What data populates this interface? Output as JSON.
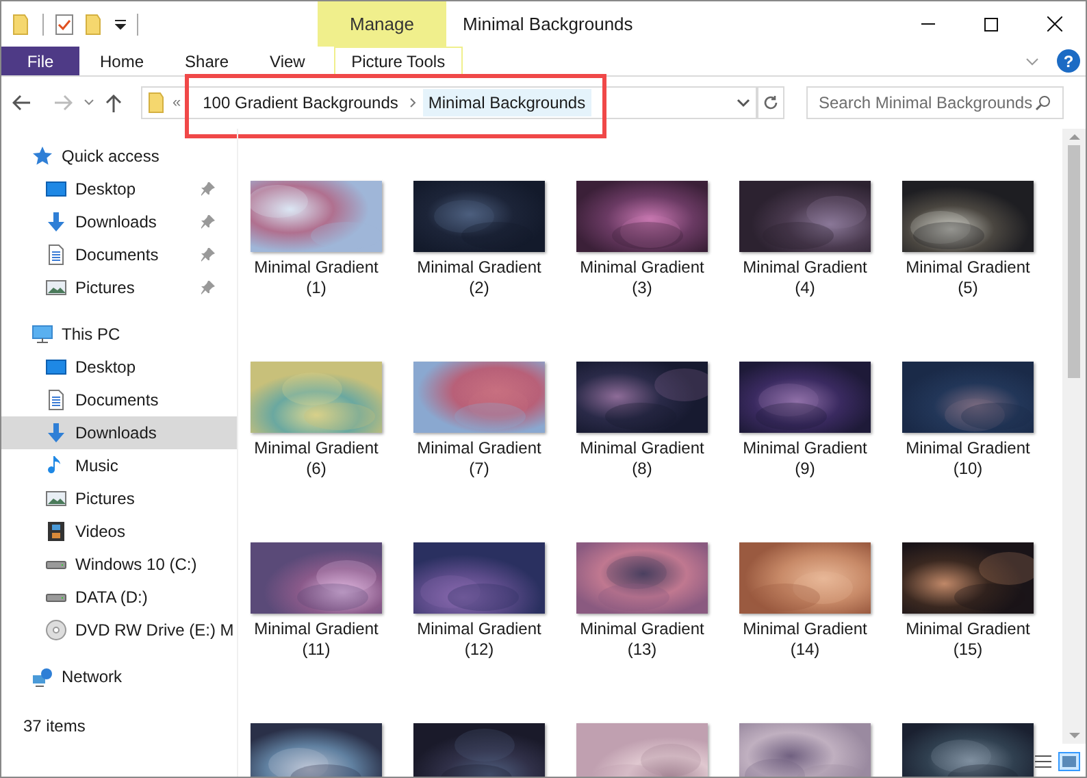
{
  "window": {
    "title": "Minimal Backgrounds"
  },
  "ribbon": {
    "context_tab": "Manage",
    "tabs": [
      {
        "label": "File",
        "kind": "file"
      },
      {
        "label": "Home",
        "kind": "tab"
      },
      {
        "label": "Share",
        "kind": "tab"
      },
      {
        "label": "View",
        "kind": "tab"
      },
      {
        "label": "Picture Tools",
        "kind": "context"
      }
    ],
    "help": "?"
  },
  "address": {
    "overflow": "«",
    "crumbs": [
      {
        "label": "100 Gradient Backgrounds",
        "selected": false
      },
      {
        "label": "Minimal Backgrounds",
        "selected": true
      }
    ]
  },
  "search": {
    "placeholder": "Search Minimal Backgrounds"
  },
  "sidebar": {
    "items": [
      {
        "label": "Quick access",
        "kind": "star",
        "selected": false,
        "children": [
          {
            "label": "Desktop",
            "kind": "desktop",
            "selected": false,
            "pinned": true
          },
          {
            "label": "Downloads",
            "kind": "download",
            "selected": false,
            "pinned": true
          },
          {
            "label": "Documents",
            "kind": "document",
            "selected": false,
            "pinned": true
          },
          {
            "label": "Pictures",
            "kind": "pictures",
            "selected": false,
            "pinned": true
          }
        ]
      },
      {
        "label": "This PC",
        "kind": "pc",
        "selected": false,
        "children": [
          {
            "label": "Desktop",
            "kind": "desktop",
            "selected": false,
            "pinned": false
          },
          {
            "label": "Documents",
            "kind": "document",
            "selected": false,
            "pinned": false
          },
          {
            "label": "Downloads",
            "kind": "download",
            "selected": true,
            "pinned": false
          },
          {
            "label": "Music",
            "kind": "music",
            "selected": false,
            "pinned": false
          },
          {
            "label": "Pictures",
            "kind": "pictures",
            "selected": false,
            "pinned": false
          },
          {
            "label": "Videos",
            "kind": "videos",
            "selected": false,
            "pinned": false
          },
          {
            "label": "Windows 10 (C:)",
            "kind": "drive",
            "selected": false,
            "pinned": false
          },
          {
            "label": "DATA (D:)",
            "kind": "drive",
            "selected": false,
            "pinned": false
          },
          {
            "label": "DVD RW Drive (E:) M",
            "kind": "dvd",
            "selected": false,
            "pinned": false
          }
        ]
      },
      {
        "label": "Network",
        "kind": "network",
        "selected": false
      }
    ]
  },
  "files": [
    {
      "kind": "file",
      "name": "Minimal Gradient",
      "number": "(1)"
    },
    {
      "kind": "file",
      "name": "Minimal Gradient",
      "number": "(2)"
    },
    {
      "kind": "file",
      "name": "Minimal Gradient",
      "number": "(3)"
    },
    {
      "kind": "file",
      "name": "Minimal Gradient",
      "number": "(4)"
    },
    {
      "kind": "file",
      "name": "Minimal Gradient",
      "number": "(5)"
    },
    {
      "kind": "file",
      "name": "Minimal Gradient",
      "number": "(6)"
    },
    {
      "kind": "file",
      "name": "Minimal Gradient",
      "number": "(7)"
    },
    {
      "kind": "file",
      "name": "Minimal Gradient",
      "number": "(8)"
    },
    {
      "kind": "file",
      "name": "Minimal Gradient",
      "number": "(9)"
    },
    {
      "kind": "file",
      "name": "Minimal Gradient",
      "number": "(10)"
    },
    {
      "kind": "file",
      "name": "Minimal Gradient",
      "number": "(11)"
    },
    {
      "kind": "file",
      "name": "Minimal Gradient",
      "number": "(12)"
    },
    {
      "kind": "file",
      "name": "Minimal Gradient",
      "number": "(13)"
    },
    {
      "kind": "file",
      "name": "Minimal Gradient",
      "number": "(14)"
    },
    {
      "kind": "file",
      "name": "Minimal Gradient",
      "number": "(15)"
    },
    {
      "kind": "picture"
    },
    {
      "kind": "picture"
    },
    {
      "kind": "picture"
    },
    {
      "kind": "picture"
    },
    {
      "kind": "picture"
    }
  ],
  "status_bar": {
    "count": "37 items"
  }
}
